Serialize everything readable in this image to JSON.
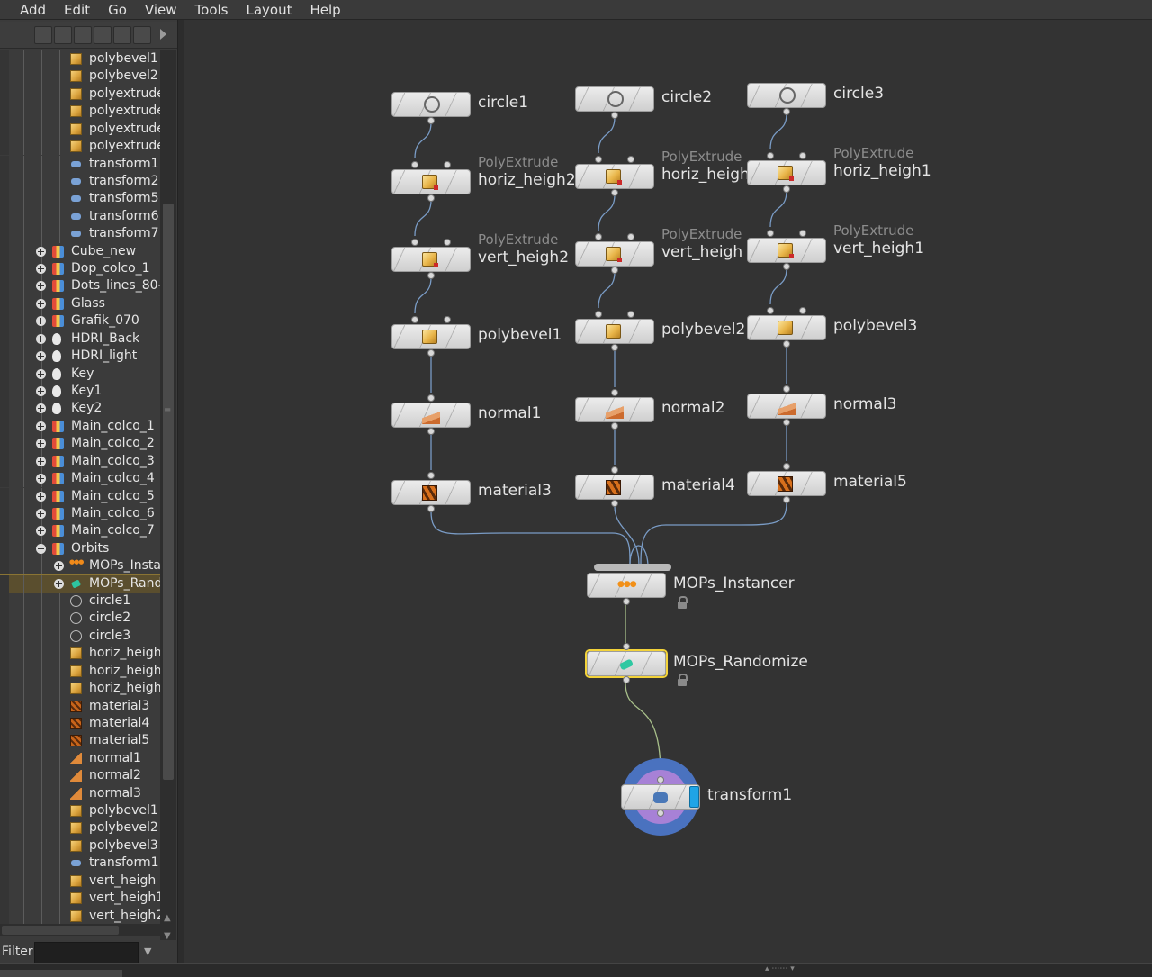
{
  "menu": [
    "Add",
    "Edit",
    "Go",
    "View",
    "Tools",
    "Layout",
    "Help"
  ],
  "filter": {
    "label": "Filter",
    "value": ""
  },
  "tree": [
    {
      "label": "polybevel1",
      "icon": "cube-icon",
      "indent": 2
    },
    {
      "label": "polybevel2",
      "icon": "cube-icon",
      "indent": 2
    },
    {
      "label": "polyextrude",
      "icon": "cube-icon",
      "indent": 2
    },
    {
      "label": "polyextrude",
      "icon": "cube-icon",
      "indent": 2
    },
    {
      "label": "polyextrude",
      "icon": "cube-icon",
      "indent": 2
    },
    {
      "label": "polyextrude",
      "icon": "cube-icon",
      "indent": 2
    },
    {
      "label": "transform1",
      "icon": "transform-icon",
      "indent": 2
    },
    {
      "label": "transform2",
      "icon": "transform-icon",
      "indent": 2
    },
    {
      "label": "transform5",
      "icon": "transform-icon",
      "indent": 2
    },
    {
      "label": "transform6",
      "icon": "transform-icon",
      "indent": 2
    },
    {
      "label": "transform7",
      "icon": "transform-icon",
      "indent": 2
    },
    {
      "label": "Cube_new",
      "icon": "object-icon",
      "indent": 1,
      "expander": "plus"
    },
    {
      "label": "Dop_colco_1",
      "icon": "object-icon",
      "indent": 1,
      "expander": "plus"
    },
    {
      "label": "Dots_lines_80-",
      "icon": "object-icon",
      "indent": 1,
      "expander": "plus"
    },
    {
      "label": "Glass",
      "icon": "object-icon",
      "indent": 1,
      "expander": "plus"
    },
    {
      "label": "Grafik_070",
      "icon": "object-icon",
      "indent": 1,
      "expander": "plus"
    },
    {
      "label": "HDRI_Back",
      "icon": "light-icon",
      "indent": 1,
      "expander": "plus"
    },
    {
      "label": "HDRI_light",
      "icon": "light-icon",
      "indent": 1,
      "expander": "plus"
    },
    {
      "label": "Key",
      "icon": "light-icon",
      "indent": 1,
      "expander": "plus"
    },
    {
      "label": "Key1",
      "icon": "light-icon",
      "indent": 1,
      "expander": "plus"
    },
    {
      "label": "Key2",
      "icon": "light-icon",
      "indent": 1,
      "expander": "plus"
    },
    {
      "label": "Main_colco_1",
      "icon": "object-icon",
      "indent": 1,
      "expander": "plus"
    },
    {
      "label": "Main_colco_2",
      "icon": "object-icon",
      "indent": 1,
      "expander": "plus"
    },
    {
      "label": "Main_colco_3",
      "icon": "object-icon",
      "indent": 1,
      "expander": "plus"
    },
    {
      "label": "Main_colco_4",
      "icon": "object-icon",
      "indent": 1,
      "expander": "plus"
    },
    {
      "label": "Main_colco_5",
      "icon": "object-icon",
      "indent": 1,
      "expander": "plus"
    },
    {
      "label": "Main_colco_6",
      "icon": "object-icon",
      "indent": 1,
      "expander": "plus"
    },
    {
      "label": "Main_colco_7",
      "icon": "object-icon",
      "indent": 1,
      "expander": "plus"
    },
    {
      "label": "Orbits",
      "icon": "object-icon",
      "indent": 1,
      "expander": "minus"
    },
    {
      "label": "MOPs_Insta",
      "icon": "instancer-icon",
      "indent": 2,
      "expander": "plus"
    },
    {
      "label": "MOPs_Rand",
      "icon": "randomize-icon",
      "indent": 2,
      "expander": "plus",
      "selected": true
    },
    {
      "label": "circle1",
      "icon": "circle-icon",
      "indent": 2
    },
    {
      "label": "circle2",
      "icon": "circle-icon",
      "indent": 2
    },
    {
      "label": "circle3",
      "icon": "circle-icon",
      "indent": 2
    },
    {
      "label": "horiz_heigh",
      "icon": "cube-icon",
      "indent": 2
    },
    {
      "label": "horiz_heigh",
      "icon": "cube-icon",
      "indent": 2
    },
    {
      "label": "horiz_heigh",
      "icon": "cube-icon",
      "indent": 2
    },
    {
      "label": "material3",
      "icon": "material-icon",
      "indent": 2
    },
    {
      "label": "material4",
      "icon": "material-icon",
      "indent": 2
    },
    {
      "label": "material5",
      "icon": "material-icon",
      "indent": 2
    },
    {
      "label": "normal1",
      "icon": "normal-icon",
      "indent": 2
    },
    {
      "label": "normal2",
      "icon": "normal-icon",
      "indent": 2
    },
    {
      "label": "normal3",
      "icon": "normal-icon",
      "indent": 2
    },
    {
      "label": "polybevel1",
      "icon": "cube-icon",
      "indent": 2
    },
    {
      "label": "polybevel2",
      "icon": "cube-icon",
      "indent": 2
    },
    {
      "label": "polybevel3",
      "icon": "cube-icon",
      "indent": 2
    },
    {
      "label": "transform1",
      "icon": "transform-icon",
      "indent": 2
    },
    {
      "label": "vert_heigh",
      "icon": "cube-icon",
      "indent": 2
    },
    {
      "label": "vert_heigh1",
      "icon": "cube-icon",
      "indent": 2
    },
    {
      "label": "vert_heigh2",
      "icon": "cube-icon",
      "indent": 2
    }
  ],
  "nodes": {
    "circle1": {
      "name": "circle1"
    },
    "circle2": {
      "name": "circle2"
    },
    "circle3": {
      "name": "circle3"
    },
    "horiz2": {
      "type": "PolyExtrude",
      "name": "horiz_heigh2"
    },
    "horiz": {
      "type": "PolyExtrude",
      "name": "horiz_heigh"
    },
    "horiz1": {
      "type": "PolyExtrude",
      "name": "horiz_heigh1"
    },
    "vert2": {
      "type": "PolyExtrude",
      "name": "vert_heigh2"
    },
    "vert": {
      "type": "PolyExtrude",
      "name": "vert_heigh"
    },
    "vert1": {
      "type": "PolyExtrude",
      "name": "vert_heigh1"
    },
    "polybevel1": {
      "name": "polybevel1"
    },
    "polybevel2": {
      "name": "polybevel2"
    },
    "polybevel3": {
      "name": "polybevel3"
    },
    "normal1": {
      "name": "normal1"
    },
    "normal2": {
      "name": "normal2"
    },
    "normal3": {
      "name": "normal3"
    },
    "material3": {
      "name": "material3"
    },
    "material4": {
      "name": "material4"
    },
    "material5": {
      "name": "material5"
    },
    "instancer": {
      "name": "MOPs_Instancer"
    },
    "randomize": {
      "name": "MOPs_Randomize"
    },
    "transform1": {
      "name": "transform1"
    }
  },
  "colors": {
    "background": "#333333",
    "wire": "#7a9cc6",
    "wire_green": "#a8c08a",
    "selected_outline": "#f3d33a",
    "display_flag": "#1fa4e6",
    "halo_outer": "#4a72bf",
    "halo_inner": "#a781d6"
  }
}
